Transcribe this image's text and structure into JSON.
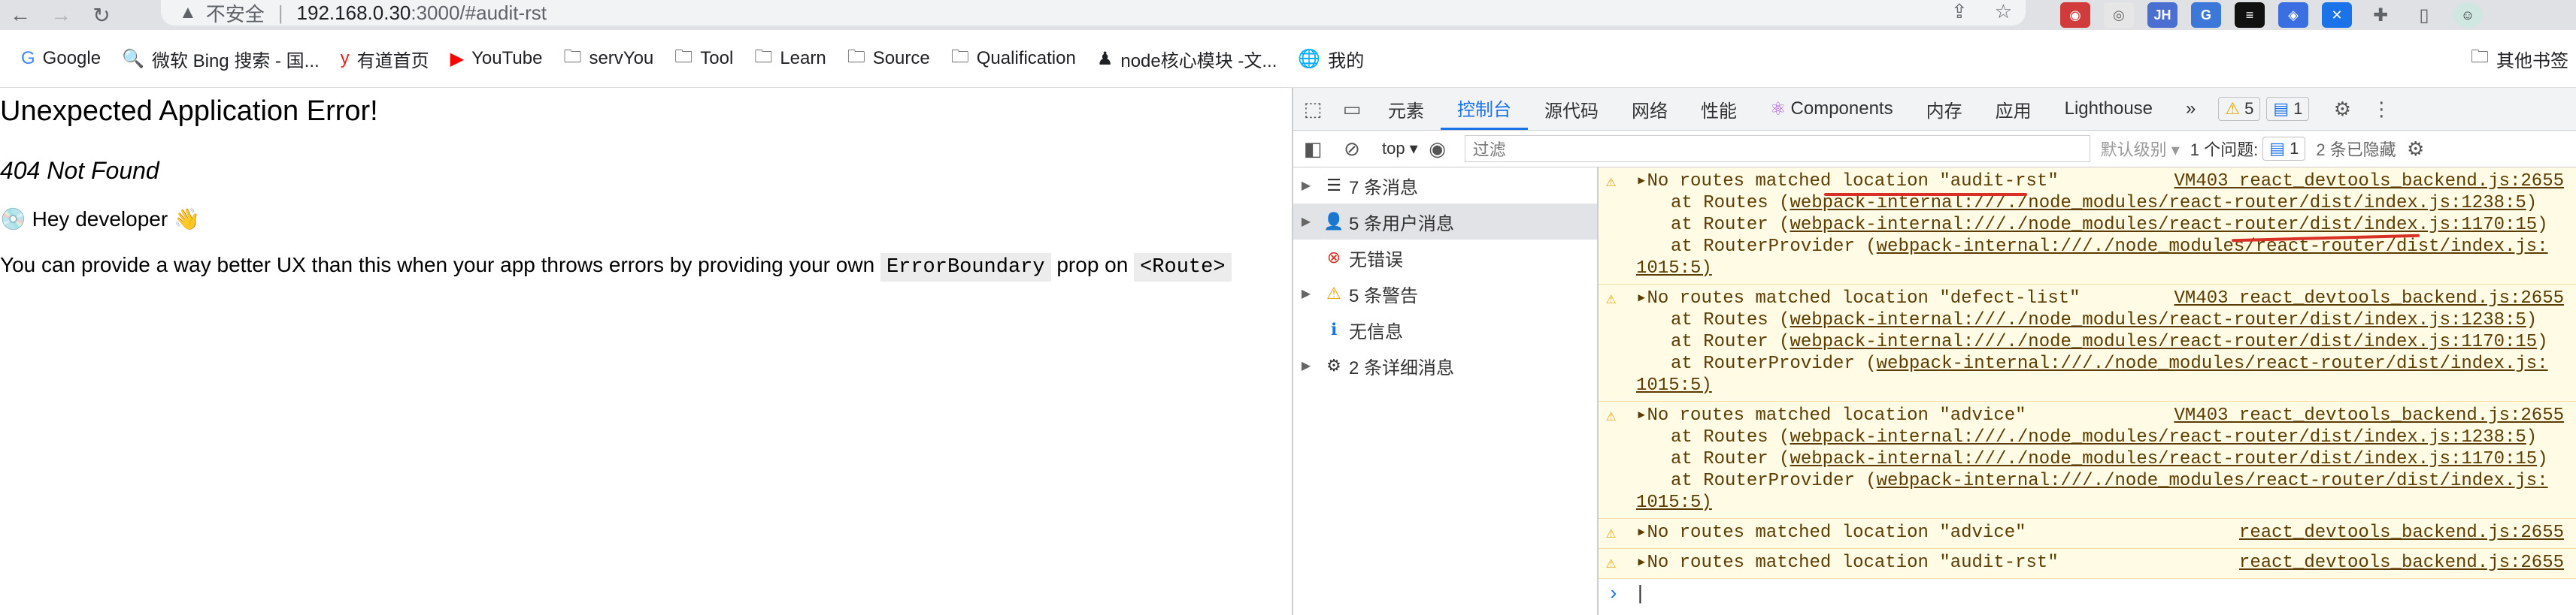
{
  "browser": {
    "insecure_label": "不安全",
    "url_host": "192.168.0.30",
    "url_rest": ":3000/#audit-rst",
    "extensions": [
      {
        "label": "JH",
        "color": "#4a6fd1"
      },
      {
        "label": "G",
        "color": "#3c78d8"
      },
      {
        "label": "≡",
        "color": "#111111"
      },
      {
        "label": "◈",
        "color": "#3b6ee0"
      },
      {
        "label": "✕",
        "color": "#1a73e8"
      }
    ]
  },
  "bookmarks": [
    {
      "icon": "G",
      "label": "Google"
    },
    {
      "icon": "🔍",
      "label": "微软 Bing 搜索 - 国..."
    },
    {
      "icon": "y",
      "label": "有道首页"
    },
    {
      "icon": "▶",
      "label": "YouTube"
    },
    {
      "icon": "🗀",
      "label": "servYou"
    },
    {
      "icon": "🗀",
      "label": "Tool"
    },
    {
      "icon": "🗀",
      "label": "Learn"
    },
    {
      "icon": "🗀",
      "label": "Source"
    },
    {
      "icon": "🗀",
      "label": "Qualification"
    },
    {
      "icon": "♟",
      "label": "node核心模块 -文..."
    },
    {
      "icon": "🌐",
      "label": "我的"
    }
  ],
  "bookmarks_other": "其他书签",
  "page": {
    "title": "Unexpected Application Error!",
    "subtitle": "404 Not Found",
    "hey": "💿 Hey developer 👋",
    "msg_prefix": "You can provide a way better UX than this when your app throws errors by providing your own ",
    "code1": "ErrorBoundary",
    "msg_mid": " prop on ",
    "code2": "<Route>"
  },
  "devtools": {
    "tabs": [
      "元素",
      "控制台",
      "源代码",
      "网络",
      "性能",
      "Components",
      "内存",
      "应用",
      "Lighthouse"
    ],
    "more_tabs": "»",
    "warn_count": "5",
    "info_count": "1",
    "context": "top",
    "filter_placeholder": "过滤",
    "level": "默认级别 ▾",
    "issues_label": "1 个问题:",
    "issues_count": "1",
    "hidden_label": "2 条已隐藏",
    "sidebar": [
      {
        "arrow": "▶",
        "icon": "☰",
        "label": "7 条消息",
        "selected": false
      },
      {
        "arrow": "▶",
        "icon": "👤",
        "label": "5 条用户消息",
        "selected": true
      },
      {
        "arrow": "",
        "icon": "⊗",
        "label": "无错误",
        "selected": false
      },
      {
        "arrow": "▶",
        "icon": "⚠",
        "label": "5 条警告",
        "selected": false
      },
      {
        "arrow": "",
        "icon": "ℹ",
        "label": "无信息",
        "selected": false
      },
      {
        "arrow": "▶",
        "icon": "⚙",
        "label": "2 条详细消息",
        "selected": false
      }
    ],
    "messages": [
      {
        "text": "▸No routes matched location \"audit-rst\"",
        "source": "VM403 react_devtools_backend.js:2655",
        "stack": [
          {
            "pre": "at Routes (",
            "link": "webpack-internal:///./node_modules/react-router/dist/index.js:1238:5",
            "post": ")"
          },
          {
            "pre": "at Router (",
            "link": "webpack-internal:///./node_modules/react-router/dist/index.js:1170:15",
            "post": ")"
          },
          {
            "pre": "at RouterProvider (",
            "link": "webpack-internal:///./node_modules/react-router/dist/index.js:",
            "post": ""
          }
        ],
        "tail": "1015:5)"
      },
      {
        "text": "▸No routes matched location \"defect-list\"",
        "source": "VM403 react_devtools_backend.js:2655",
        "stack": [
          {
            "pre": "at Routes (",
            "link": "webpack-internal:///./node_modules/react-router/dist/index.js:1238:5",
            "post": ")"
          },
          {
            "pre": "at Router (",
            "link": "webpack-internal:///./node_modules/react-router/dist/index.js:1170:15",
            "post": ")"
          },
          {
            "pre": "at RouterProvider (",
            "link": "webpack-internal:///./node_modules/react-router/dist/index.js:",
            "post": ""
          }
        ],
        "tail": "1015:5)"
      },
      {
        "text": "▸No routes matched location \"advice\"",
        "source": "VM403 react_devtools_backend.js:2655",
        "stack": [
          {
            "pre": "at Routes (",
            "link": "webpack-internal:///./node_modules/react-router/dist/index.js:1238:5",
            "post": ")"
          },
          {
            "pre": "at Router (",
            "link": "webpack-internal:///./node_modules/react-router/dist/index.js:1170:15",
            "post": ")"
          },
          {
            "pre": "at RouterProvider (",
            "link": "webpack-internal:///./node_modules/react-router/dist/index.js:",
            "post": ""
          }
        ],
        "tail": "1015:5)"
      },
      {
        "text": "▸No routes matched location \"advice\"",
        "source": "react_devtools_backend.js:2655",
        "stack": [],
        "tail": ""
      },
      {
        "text": "▸No routes matched location \"audit-rst\"",
        "source": "react_devtools_backend.js:2655",
        "stack": [],
        "tail": ""
      }
    ],
    "prompt": "›",
    "accent_color": "#1a73e8",
    "warning_color": "#e8a100",
    "annotation_color": "#d93025"
  }
}
